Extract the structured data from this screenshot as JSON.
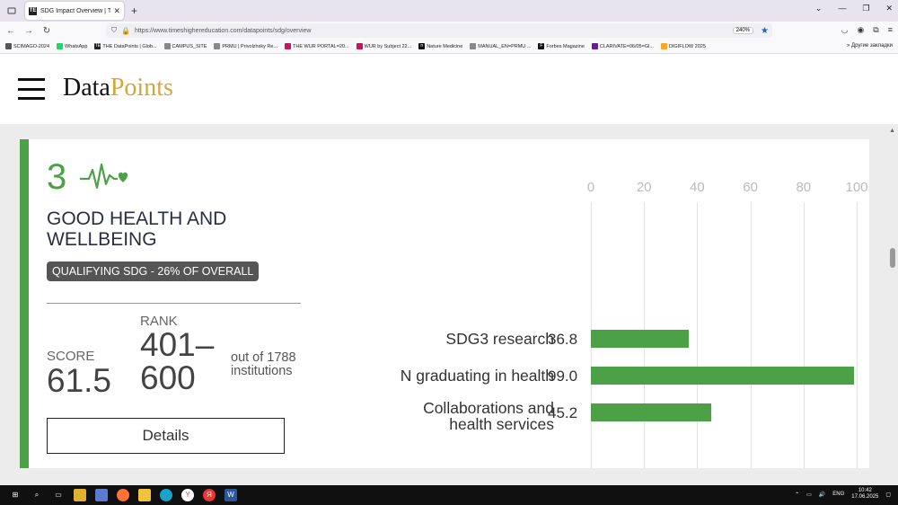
{
  "browser": {
    "tab_title": "SDG Impact Overview | THE Dat",
    "tab_favicon": "TE",
    "url": "https://www.timeshighereducation.com/datapoints/sdg/overview",
    "zoom": "240%",
    "bookmarks": [
      {
        "label": "SCIMAGO-2024",
        "color": "#555555",
        "glyph": ""
      },
      {
        "label": "WhatsApp",
        "color": "#25d366",
        "glyph": ""
      },
      {
        "label": "THE DataPoints | Glob...",
        "color": "#222222",
        "glyph": "TE"
      },
      {
        "label": "CAMPUS_SITE",
        "color": "#888888",
        "glyph": ""
      },
      {
        "label": "PRMU | Privolzhsky Re...",
        "color": "#888888",
        "glyph": ""
      },
      {
        "label": "THE WUR PORTAL=20...",
        "color": "#c2185b",
        "glyph": ""
      },
      {
        "label": "WUR by Subject 22...",
        "color": "#c2185b",
        "glyph": ""
      },
      {
        "label": "Nature Medicine",
        "color": "#111111",
        "glyph": "n"
      },
      {
        "label": "MANUAL_EN=PRMU ...",
        "color": "#888888",
        "glyph": ""
      },
      {
        "label": "Forbes Magazine",
        "color": "#111111",
        "glyph": "F"
      },
      {
        "label": "CLARIVATE=06/05=Gl...",
        "color": "#6a1b9a",
        "glyph": ""
      },
      {
        "label": "DIGIFLOW 2025",
        "color": "#f9a825",
        "glyph": ""
      }
    ],
    "other_bookmarks": "Другие закладки"
  },
  "site": {
    "logo_main": "Data",
    "logo_accent": "Points"
  },
  "sdg": {
    "number": "3",
    "title": "GOOD HEALTH AND WELLBEING",
    "badge": "QUALIFYING SDG - 26% OF OVERALL",
    "score_label": "SCORE",
    "score_value": "61.5",
    "rank_label": "RANK",
    "rank_value": "401–600",
    "out_of": "out of 1788 institutions",
    "details_label": "Details"
  },
  "colors": {
    "sdg_green": "#4ca146",
    "logo_gold": "#d3a63a"
  },
  "chart_data": {
    "type": "bar",
    "orientation": "horizontal",
    "categories": [
      "SDG3 research",
      "N graduating in health",
      "Collaborations and health services"
    ],
    "values": [
      36.8,
      99.0,
      45.2
    ],
    "value_labels": [
      "36.8",
      "99.0",
      "45.2"
    ],
    "xticks": [
      "0",
      "20",
      "40",
      "60",
      "80",
      "100"
    ],
    "xlim": [
      0,
      100
    ],
    "grid": true
  },
  "taskbar": {
    "time": "10:42",
    "date": "17.06.2025",
    "lang": "ENG"
  }
}
